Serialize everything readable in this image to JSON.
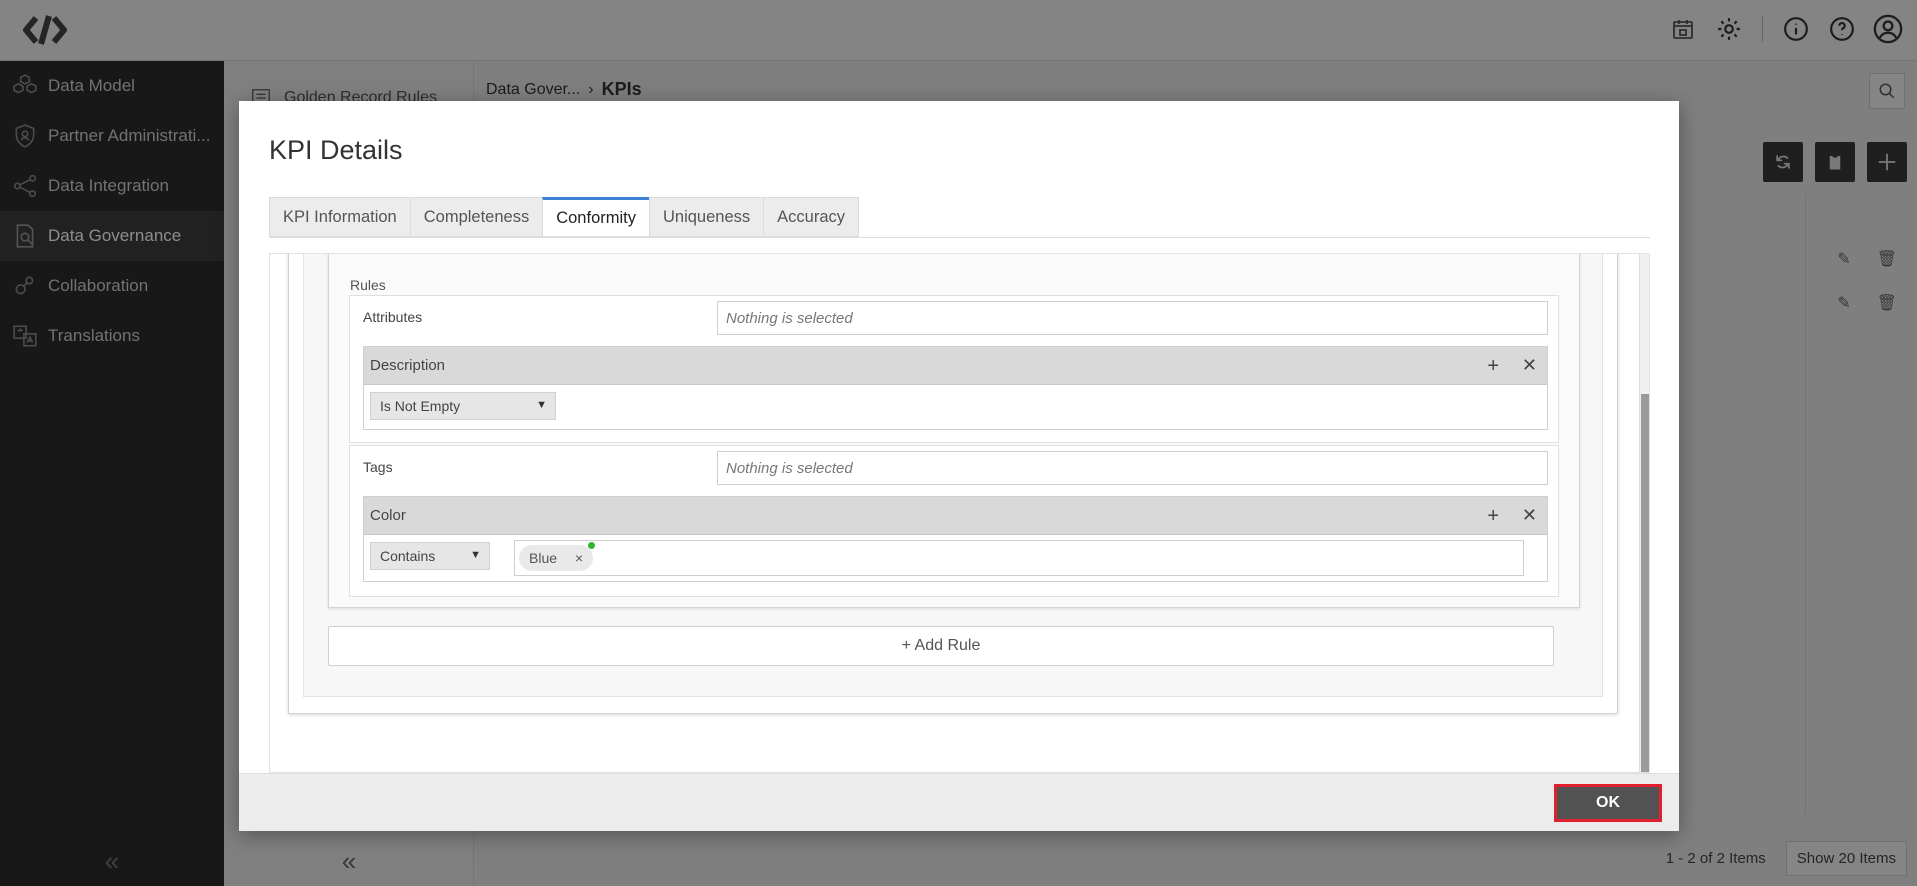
{
  "topbar": {
    "icons": [
      "calendar-icon",
      "gear-icon",
      "info-icon",
      "help-icon",
      "user-icon"
    ]
  },
  "sidebar": {
    "items": [
      {
        "label": "Data Model",
        "icon": "cubes-icon",
        "active": false
      },
      {
        "label": "Partner Administrati...",
        "icon": "shield-icon",
        "active": false
      },
      {
        "label": "Data Integration",
        "icon": "share-icon",
        "active": false
      },
      {
        "label": "Data Governance",
        "icon": "document-search-icon",
        "active": true
      },
      {
        "label": "Collaboration",
        "icon": "collaboration-icon",
        "active": false
      },
      {
        "label": "Translations",
        "icon": "translate-icon",
        "active": false
      }
    ],
    "collapse": "«"
  },
  "subpanel": {
    "item": "Golden Record Rules",
    "collapse": "«"
  },
  "main": {
    "breadcrumb": {
      "parent": "Data Gover...",
      "separator": "›",
      "current": "KPIs"
    },
    "pager": {
      "summary": "1 - 2 of 2 Items",
      "show": "Show 20 Items"
    }
  },
  "modal": {
    "title": "KPI Details",
    "tabs": [
      {
        "label": "KPI Information",
        "active": false
      },
      {
        "label": "Completeness",
        "active": false
      },
      {
        "label": "Conformity",
        "active": true
      },
      {
        "label": "Uniqueness",
        "active": false
      },
      {
        "label": "Accuracy",
        "active": false
      }
    ],
    "rules_label": "Rules",
    "rule_blocks": [
      {
        "label": "Attributes",
        "selector_placeholder": "Nothing is selected",
        "item": {
          "name": "Description",
          "operator": "Is Not Empty"
        }
      },
      {
        "label": "Tags",
        "selector_placeholder": "Nothing is selected",
        "item": {
          "name": "Color",
          "operator": "Contains",
          "values": [
            "Blue"
          ]
        }
      }
    ],
    "add_rule": "+ Add Rule",
    "ok": "OK"
  },
  "colors": {
    "accent_tab": "#3b82d4",
    "ok_highlight": "#e0202f",
    "chip_dot": "#2eb82e"
  }
}
